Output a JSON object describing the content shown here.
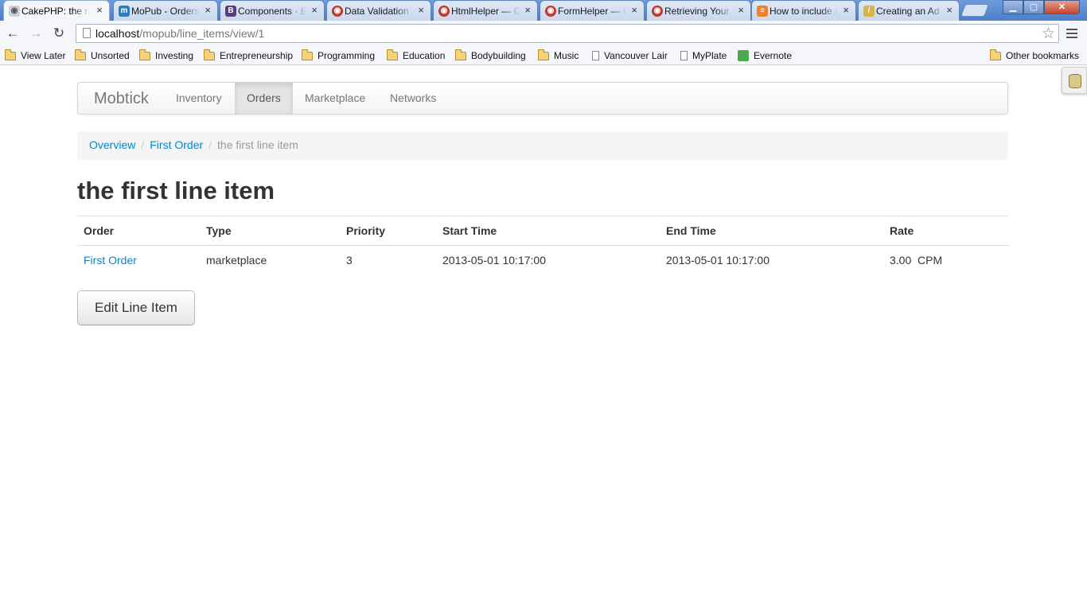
{
  "browser": {
    "tabs": [
      {
        "title": "CakePHP: the rapid",
        "icon": "cakephp-icon",
        "active": true
      },
      {
        "title": "MoPub - Orders",
        "icon": "mopub-icon"
      },
      {
        "title": "Components · Bootstrap",
        "icon": "bootstrap-icon"
      },
      {
        "title": "Data Validation",
        "icon": "cakephp-icon"
      },
      {
        "title": "HtmlHelper — CakePHP",
        "icon": "cakephp-icon"
      },
      {
        "title": "FormHelper — CakePHP",
        "icon": "cakephp-icon"
      },
      {
        "title": "Retrieving Your Data",
        "icon": "cakephp-icon"
      },
      {
        "title": "How to include a",
        "icon": "stackoverflow-icon"
      },
      {
        "title": "Creating an Ad",
        "icon": "pencil-icon"
      }
    ],
    "window_controls": {
      "minimize": "▁",
      "maximize": "▢",
      "close": "✕"
    },
    "address": {
      "host": "localhost",
      "path": "/mopub/line_items/view/1"
    },
    "bookmarks": [
      {
        "label": "View Later",
        "type": "folder"
      },
      {
        "label": "Unsorted",
        "type": "folder"
      },
      {
        "label": "Investing",
        "type": "folder"
      },
      {
        "label": "Entrepreneurship",
        "type": "folder"
      },
      {
        "label": "Programming",
        "type": "folder"
      },
      {
        "label": "Education",
        "type": "folder"
      },
      {
        "label": "Bodybuilding",
        "type": "folder"
      },
      {
        "label": "Music",
        "type": "folder"
      },
      {
        "label": "Vancouver Lair",
        "type": "page"
      },
      {
        "label": "MyPlate",
        "type": "page"
      },
      {
        "label": "Evernote",
        "type": "evernote"
      }
    ],
    "other_bookmarks": "Other bookmarks"
  },
  "navbar": {
    "brand": "Mobtick",
    "items": [
      {
        "label": "Inventory",
        "active": false
      },
      {
        "label": "Orders",
        "active": true
      },
      {
        "label": "Marketplace",
        "active": false
      },
      {
        "label": "Networks",
        "active": false
      }
    ]
  },
  "breadcrumb": {
    "items": [
      "Overview",
      "First Order"
    ],
    "current": "the first line item",
    "separator": "/"
  },
  "page": {
    "title": "the first line item",
    "table": {
      "headers": [
        "Order",
        "Type",
        "Priority",
        "Start Time",
        "End Time",
        "Rate"
      ],
      "row": {
        "order": "First Order",
        "type": "marketplace",
        "priority": "3",
        "start_time": "2013-05-01 10:17:00",
        "end_time": "2013-05-01 10:17:00",
        "rate": "3.00  CPM"
      }
    },
    "edit_button": "Edit Line Item"
  },
  "colors": {
    "link": "#0088cc",
    "tabstrip": "#4c7fc9"
  }
}
